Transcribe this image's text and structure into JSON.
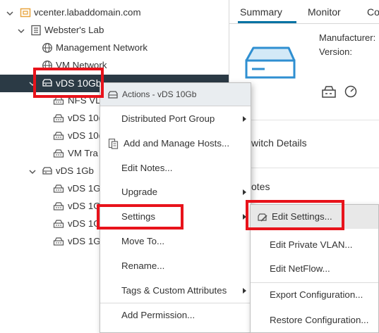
{
  "tree": {
    "items": [
      {
        "label": "vcenter.labaddomain.com"
      },
      {
        "label": "Webster's Lab"
      },
      {
        "label": "Management Network"
      },
      {
        "label": "VM Network"
      },
      {
        "label": "vDS 10Gb"
      },
      {
        "label": "NFS VL"
      },
      {
        "label": "vDS 10("
      },
      {
        "label": "vDS 10("
      },
      {
        "label": "VM Tra"
      },
      {
        "label": "vDS 1Gb"
      },
      {
        "label": "vDS 1G"
      },
      {
        "label": "vDS 1G"
      },
      {
        "label": "vDS 1G"
      },
      {
        "label": "vDS 1G"
      }
    ]
  },
  "right": {
    "tabs": [
      "Summary",
      "Monitor",
      "Co"
    ],
    "manufacturer_label": "Manufacturer:",
    "version_label": "Version:",
    "switch_details": "witch Details",
    "notes": "otes"
  },
  "context_menu": {
    "header": "Actions - vDS 10Gb",
    "items": [
      {
        "label": "Distributed Port Group"
      },
      {
        "label": "Add and Manage Hosts..."
      },
      {
        "label": "Edit Notes..."
      },
      {
        "label": "Upgrade"
      },
      {
        "label": "Settings"
      },
      {
        "label": "Move To..."
      },
      {
        "label": "Rename..."
      },
      {
        "label": "Tags & Custom Attributes"
      },
      {
        "label": "Add Permission..."
      }
    ]
  },
  "submenu": {
    "items": [
      {
        "label": "Edit Settings..."
      },
      {
        "label": "Edit Private VLAN..."
      },
      {
        "label": "Edit NetFlow..."
      },
      {
        "label": "Export Configuration..."
      },
      {
        "label": "Restore Configuration..."
      }
    ]
  },
  "colors": {
    "selected_row": "#2b3a45",
    "highlight_red": "#e8131b",
    "tab_accent": "#0072a3",
    "datacenter_orange": "#e8a33d",
    "switch_blue": "#2f8fd1"
  }
}
